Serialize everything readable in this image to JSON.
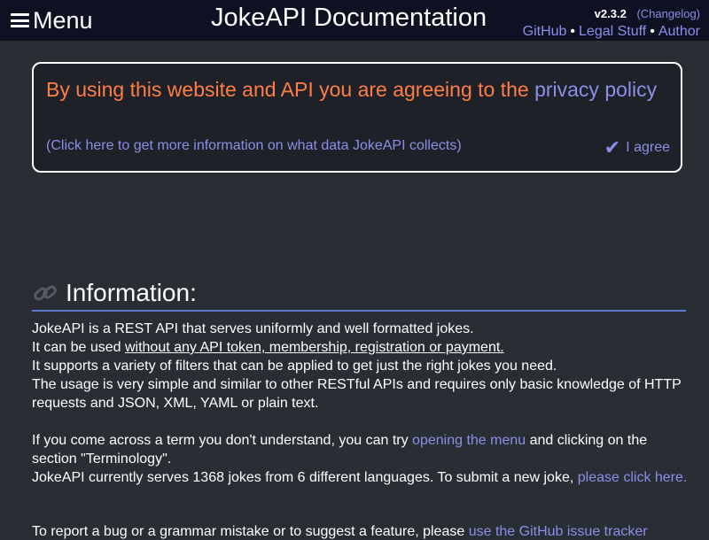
{
  "header": {
    "menu_label": "Menu",
    "title": "JokeAPI Documentation",
    "version": "v2.3.2",
    "changelog": "(Changelog)",
    "links": [
      "GitHub",
      "Legal Stuff",
      "Author"
    ],
    "separator": "•"
  },
  "banner": {
    "text": "By using this website and API you are agreeing to the ",
    "policy_link": "privacy policy",
    "more_info": "(Click here to get more information on what data JokeAPI collects)",
    "agree_check": "✔",
    "agree_label": "I agree"
  },
  "info": {
    "title": "Information:",
    "line1": "JokeAPI is a REST API that serves uniformly and well formatted jokes.",
    "line2_prefix": "It can be used ",
    "line2_underlined": "without any API token, membership, registration or payment.",
    "line3": "It supports a variety of filters that can be applied to get just the right jokes you need.",
    "line4": "The usage is very simple and similar to other RESTful APIs and requires only basic knowledge of HTTP requests and JSON, XML, YAML or plain text.",
    "line5_prefix": "If you come across a term you don't understand, you can try ",
    "line5_link": "opening the menu",
    "line5_suffix": " and clicking on the section \"Terminology\".",
    "line6_prefix": "JokeAPI currently serves 1368 jokes from 6 different languages. To submit a new joke, ",
    "line6_link": "please click here.",
    "line7_prefix": "To report a bug or a grammar mistake or to suggest a feature, please ",
    "line7_link": "use the GitHub issue tracker"
  }
}
